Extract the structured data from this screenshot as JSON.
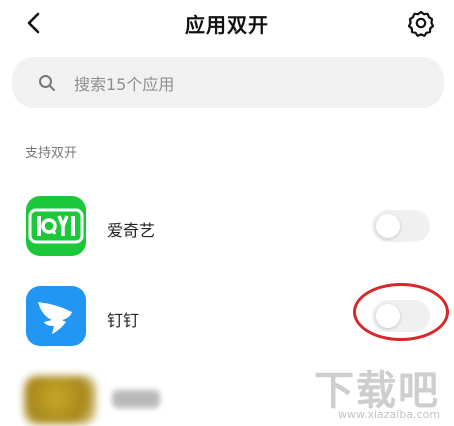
{
  "header": {
    "title": "应用双开"
  },
  "search": {
    "placeholder": "搜索15个应用"
  },
  "section": {
    "label": "支持双开"
  },
  "apps": [
    {
      "name": "爱奇艺",
      "icon": "iqiyi-logo",
      "toggle_on": false,
      "color": "#1ac83a"
    },
    {
      "name": "钉钉",
      "icon": "dingtalk-logo",
      "toggle_on": false,
      "color": "#2196f3"
    }
  ],
  "watermark": {
    "text": "下载吧",
    "url": "www.xiazaiba.com"
  },
  "colors": {
    "highlight_ring": "#d8262a",
    "search_bg": "#f1f1f1"
  },
  "icons": [
    "chevron-left-icon",
    "gear-icon",
    "search-icon"
  ]
}
